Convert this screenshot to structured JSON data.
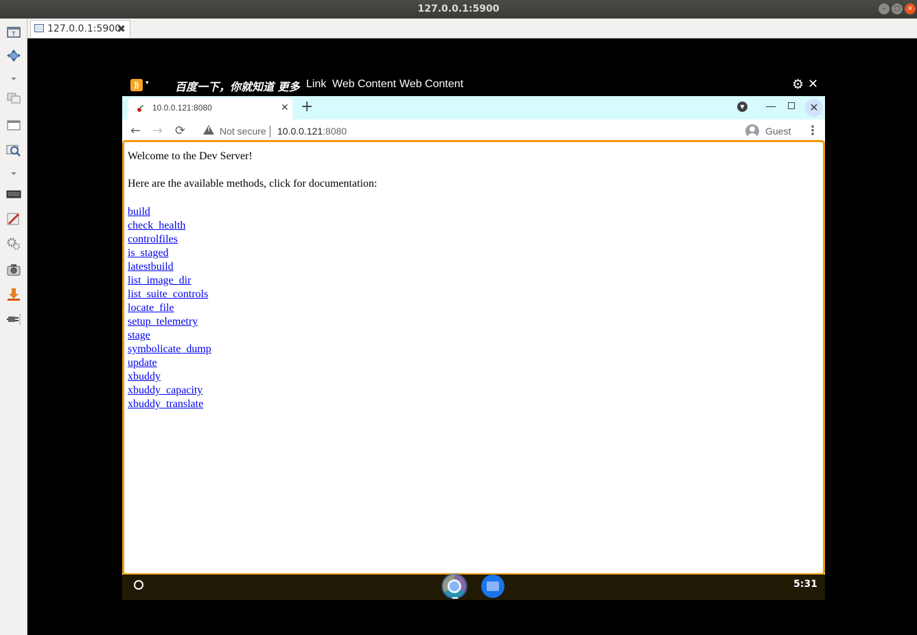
{
  "window": {
    "title": "127.0.0.1:5900",
    "controls": {
      "minimize": "–",
      "maximize": "□",
      "close": "×"
    }
  },
  "viewer": {
    "tab_label": "127.0.0.1:5900",
    "tab_close": "✖",
    "sidebar_icons": [
      "fit-window-icon",
      "move-icon",
      "dropdown-icon",
      "clone-icon",
      "window-icon",
      "zoom-icon",
      "dropdown-icon",
      "keyboard-icon",
      "pen-icon",
      "settings-icon",
      "screenshot-icon",
      "download-icon",
      "plug-icon"
    ]
  },
  "os_menubar": {
    "app_icon_glyph": "⟫",
    "dropdown_glyph": "▾",
    "title": "百度一下，你就知道  更多",
    "items": [
      "Link",
      "Web Content",
      "Web Content"
    ],
    "gear_glyph": "⚙",
    "close_glyph": "✕"
  },
  "chrome": {
    "tab": {
      "title": "10.0.0.121:8080",
      "close": "✕"
    },
    "new_tab": "+",
    "tab_search_glyph": "▼",
    "minimize": "—",
    "close": "✕",
    "nav": {
      "back": "←",
      "forward": "→",
      "reload": "⟳"
    },
    "security": "Not secure",
    "url_host": "10.0.0.121",
    "url_port": ":8080",
    "profile": "Guest",
    "menu": "⋮"
  },
  "page": {
    "welcome": "Welcome to the Dev Server!",
    "intro": "Here are the available methods, click for documentation:",
    "methods": [
      "build",
      "check_health",
      "controlfiles",
      "is_staged",
      "latestbuild",
      "list_image_dir",
      "list_suite_controls",
      "locate_file",
      "setup_telemetry",
      "stage",
      "symbolicate_dump",
      "update",
      "xbuddy",
      "xbuddy_capacity",
      "xbuddy_translate"
    ]
  },
  "shelf": {
    "clock": "5:31",
    "apps": [
      "chrome-icon",
      "files-icon"
    ]
  },
  "colors": {
    "focus_ring": "#f29900",
    "tabstrip": "#d6fafd",
    "link": "#0000ee",
    "shelf": "#211a05"
  }
}
